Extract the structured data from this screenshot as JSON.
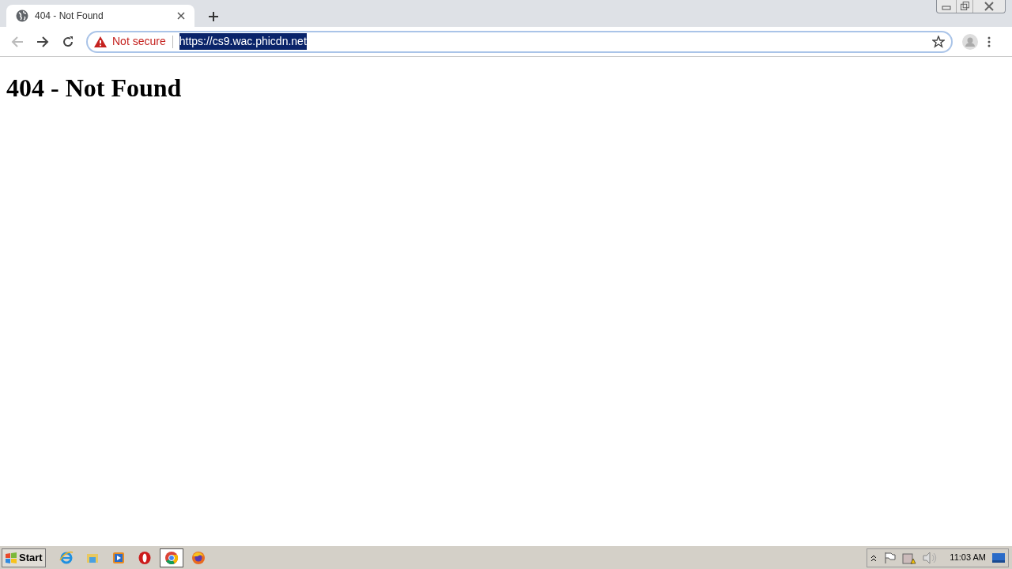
{
  "tab": {
    "title": "404 - Not Found",
    "selected": true
  },
  "address_bar": {
    "security": "Not secure",
    "url": "https://cs9.wac.phicdn.net",
    "url_selected": true
  },
  "page": {
    "heading": "404 - Not Found"
  },
  "taskbar": {
    "start": "Start",
    "apps": [
      {
        "kind": "ie",
        "selected": false
      },
      {
        "kind": "folder",
        "selected": false
      },
      {
        "kind": "media",
        "selected": false
      },
      {
        "kind": "opera",
        "selected": false
      },
      {
        "kind": "chrome",
        "selected": true
      },
      {
        "kind": "firefox",
        "selected": false
      }
    ],
    "clock": "11:03 AM"
  }
}
